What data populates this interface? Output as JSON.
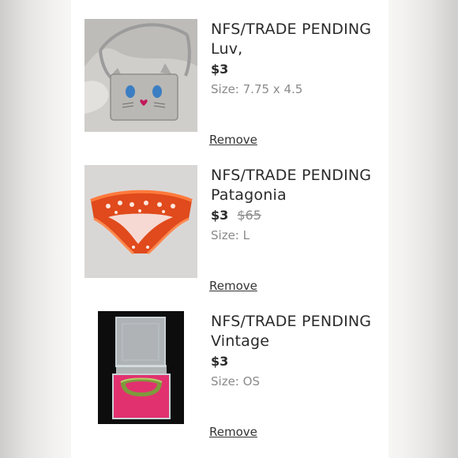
{
  "items": [
    {
      "title": "NFS/TRADE PENDING Luv,",
      "price": "$3",
      "original_price": "",
      "size_label": "Size:",
      "size_value": "7.75 x 4.5",
      "remove_label": "Remove",
      "image_icon": "cat-purse-photo"
    },
    {
      "title": "NFS/TRADE PENDING Patagonia",
      "price": "$3",
      "original_price": "$65",
      "size_label": "Size:",
      "size_value": "L",
      "remove_label": "Remove",
      "image_icon": "red-underwear-photo"
    },
    {
      "title": "NFS/TRADE PENDING Vintage",
      "price": "$3",
      "original_price": "",
      "size_label": "Size:",
      "size_value": "OS",
      "remove_label": "Remove",
      "image_icon": "ring-box-photo"
    }
  ],
  "colors": {
    "accent_link": "#333333",
    "muted_text": "#8a8a8a",
    "strike_text": "#8a8a8a"
  }
}
